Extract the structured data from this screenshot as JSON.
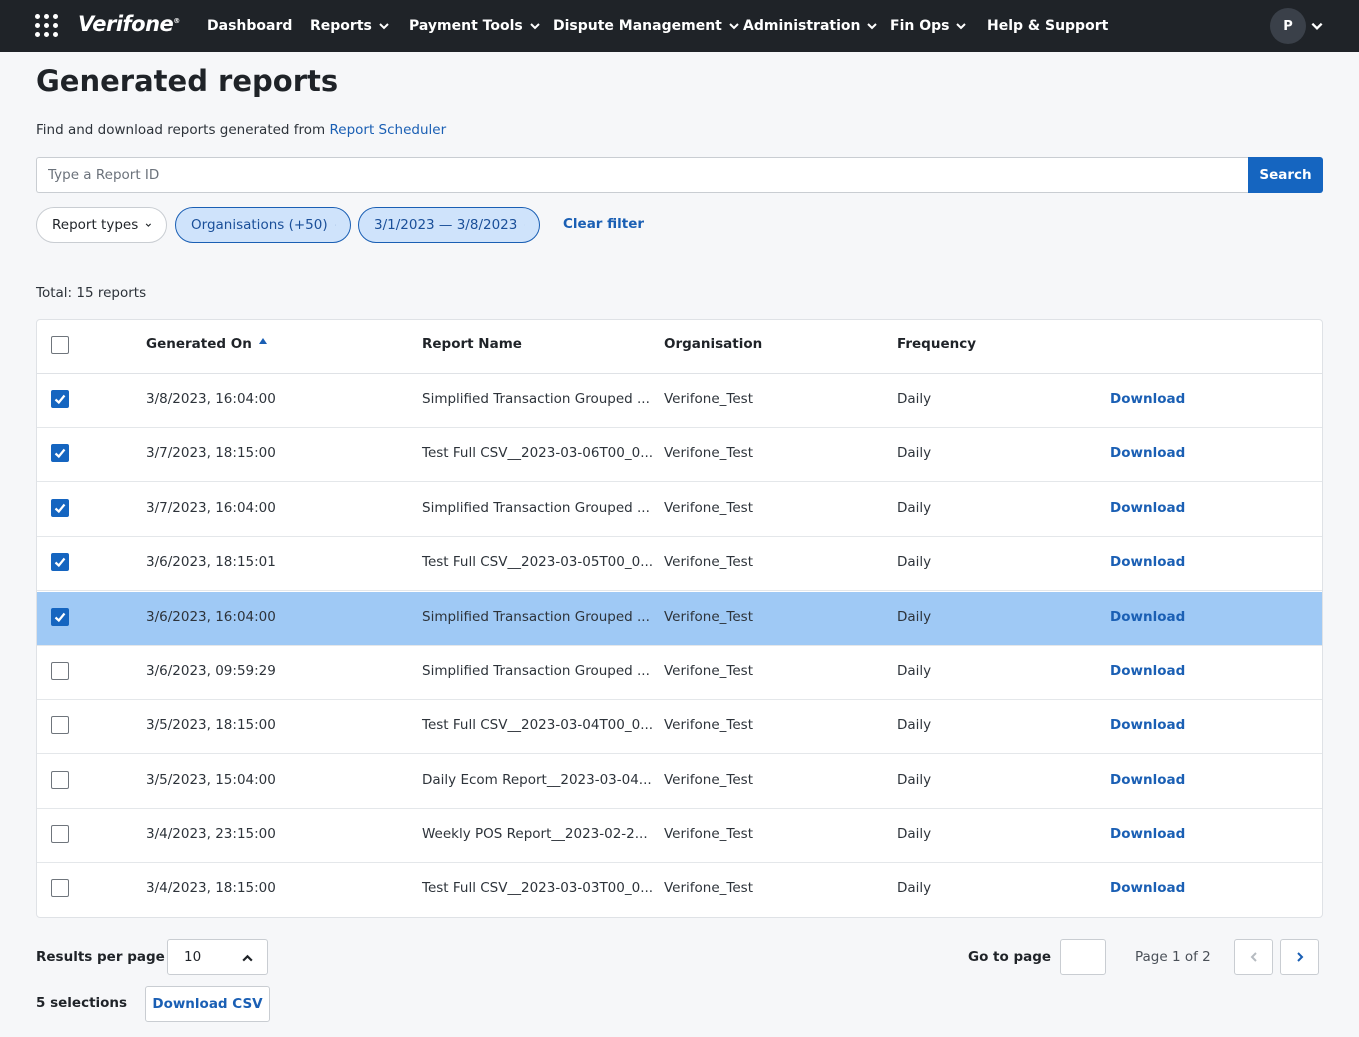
{
  "nav": {
    "logo": "Verifone",
    "items": [
      {
        "label": "Dashboard",
        "has_menu": false
      },
      {
        "label": "Reports",
        "has_menu": true
      },
      {
        "label": "Payment Tools",
        "has_menu": true
      },
      {
        "label": "Dispute Management",
        "has_menu": true
      },
      {
        "label": "Administration",
        "has_menu": true
      },
      {
        "label": "Fin Ops",
        "has_menu": true
      },
      {
        "label": "Help & Support",
        "has_menu": false
      }
    ],
    "avatar_initial": "P"
  },
  "header": {
    "title": "Generated reports",
    "subtitle": "Find and download reports generated from ",
    "subtitle_link": "Report Scheduler"
  },
  "search": {
    "placeholder": "Type a Report ID",
    "value": "",
    "button_label": "Search"
  },
  "filters": {
    "report_types": "Report types",
    "organisations": "Organisations (+50)",
    "date_range": "3/1/2023 — 3/8/2023",
    "clear": "Clear filter"
  },
  "total": "Total: 15 reports",
  "table": {
    "columns": [
      "Generated On",
      "Report Name",
      "Organisation",
      "Frequency"
    ],
    "sort_column": "Generated On",
    "sort_direction": "ascending",
    "action_label": "Download",
    "rows": [
      {
        "checked": true,
        "highlight": false,
        "generated_on": "3/8/2023, 16:04:00",
        "report_name": "Simplified Transaction Grouped ...",
        "organisation": "Verifone_Test",
        "frequency": "Daily"
      },
      {
        "checked": true,
        "highlight": false,
        "generated_on": "3/7/2023, 18:15:00",
        "report_name": "Test Full CSV__2023-03-06T00_0...",
        "organisation": "Verifone_Test",
        "frequency": "Daily"
      },
      {
        "checked": true,
        "highlight": false,
        "generated_on": "3/7/2023, 16:04:00",
        "report_name": "Simplified Transaction Grouped ...",
        "organisation": "Verifone_Test",
        "frequency": "Daily"
      },
      {
        "checked": true,
        "highlight": false,
        "generated_on": "3/6/2023, 18:15:01",
        "report_name": "Test Full CSV__2023-03-05T00_0...",
        "organisation": "Verifone_Test",
        "frequency": "Daily"
      },
      {
        "checked": true,
        "highlight": true,
        "generated_on": "3/6/2023, 16:04:00",
        "report_name": "Simplified Transaction Grouped ...",
        "organisation": "Verifone_Test",
        "frequency": "Daily"
      },
      {
        "checked": false,
        "highlight": false,
        "generated_on": "3/6/2023, 09:59:29",
        "report_name": "Simplified Transaction Grouped ...",
        "organisation": "Verifone_Test",
        "frequency": "Daily"
      },
      {
        "checked": false,
        "highlight": false,
        "generated_on": "3/5/2023, 18:15:00",
        "report_name": "Test Full CSV__2023-03-04T00_0...",
        "organisation": "Verifone_Test",
        "frequency": "Daily"
      },
      {
        "checked": false,
        "highlight": false,
        "generated_on": "3/5/2023, 15:04:00",
        "report_name": "Daily Ecom Report__2023-03-04...",
        "organisation": "Verifone_Test",
        "frequency": "Daily"
      },
      {
        "checked": false,
        "highlight": false,
        "generated_on": "3/4/2023, 23:15:00",
        "report_name": "Weekly POS Report__2023-02-2...",
        "organisation": "Verifone_Test",
        "frequency": "Daily"
      },
      {
        "checked": false,
        "highlight": false,
        "generated_on": "3/4/2023, 18:15:00",
        "report_name": "Test Full CSV__2023-03-03T00_0...",
        "organisation": "Verifone_Test",
        "frequency": "Daily"
      }
    ]
  },
  "footer": {
    "results_per_page_label": "Results per page",
    "results_per_page": "10",
    "selections": "5 selections",
    "download_csv": "Download CSV",
    "goto_label": "Go to page",
    "goto_value": "",
    "page_info": "Page 1 of 2"
  },
  "colors": {
    "nav_bg": "#1f2328",
    "primary": "#1565c0",
    "link": "#1a5fb4",
    "row_highlight": "#9fc9f5",
    "pill_active_bg": "#cfe3fb"
  }
}
